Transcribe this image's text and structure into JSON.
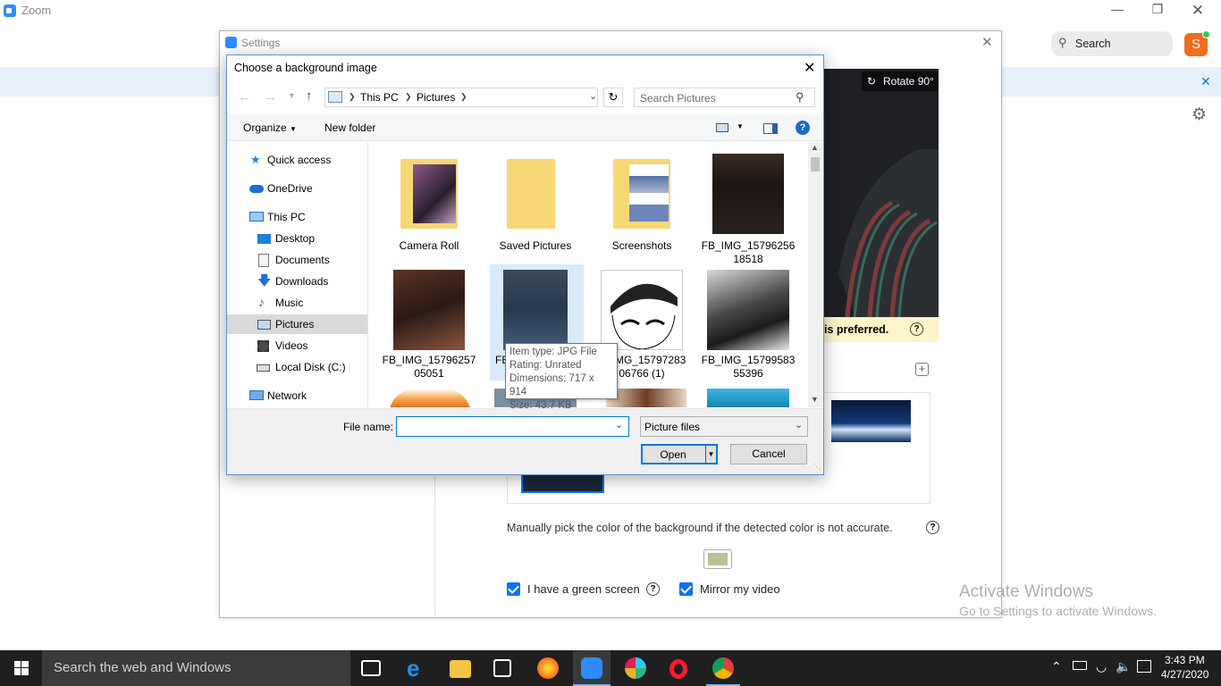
{
  "zoom": {
    "title": "Zoom",
    "search_label": "Search",
    "avatar_letter": "S"
  },
  "settings": {
    "title": "Settings",
    "rotate_label": "Rotate 90°",
    "warning_text": "is preferred.",
    "manual_pick_text": "Manually pick the color of the background if the detected color is not accurate.",
    "green_screen_label": "I have a green screen",
    "mirror_label": "Mirror my video",
    "swatch_color": "#b6c394"
  },
  "dialog": {
    "title": "Choose a background image",
    "breadcrumb": [
      "This PC",
      "Pictures"
    ],
    "search_placeholder": "Search Pictures",
    "organize_label": "Organize",
    "new_folder_label": "New folder",
    "nav": {
      "quick_access": "Quick access",
      "onedrive": "OneDrive",
      "this_pc": "This PC",
      "desktop": "Desktop",
      "documents": "Documents",
      "downloads": "Downloads",
      "music": "Music",
      "pictures": "Pictures",
      "videos": "Videos",
      "local_disk": "Local Disk (C:)",
      "network": "Network"
    },
    "files": [
      {
        "name_line1": "Camera Roll",
        "name_line2": ""
      },
      {
        "name_line1": "Saved Pictures",
        "name_line2": ""
      },
      {
        "name_line1": "Screenshots",
        "name_line2": ""
      },
      {
        "name_line1": "FB_IMG_15796256",
        "name_line2": "18518"
      },
      {
        "name_line1": "FB_IMG_15796257",
        "name_line2": "05051"
      },
      {
        "name_line1": "FB",
        "name_line2": ""
      },
      {
        "name_line1": "IMG_15797283",
        "name_line2": "06766 (1)"
      },
      {
        "name_line1": "FB_IMG_15799583",
        "name_line2": "55396"
      }
    ],
    "tooltip": {
      "type": "Item type: JPG File",
      "rating": "Rating: Unrated",
      "dimensions": "Dimensions: 717 x 914",
      "size": "Size: 43.7 KB"
    },
    "file_name_label": "File name:",
    "file_name_value": "",
    "filter_value": "Picture files",
    "open_label": "Open",
    "cancel_label": "Cancel"
  },
  "activate": {
    "title": "Activate Windows",
    "subtitle": "Go to Settings to activate Windows."
  },
  "taskbar": {
    "search_text": "Search the web and Windows",
    "time": "3:43 PM",
    "date": "4/27/2020"
  }
}
